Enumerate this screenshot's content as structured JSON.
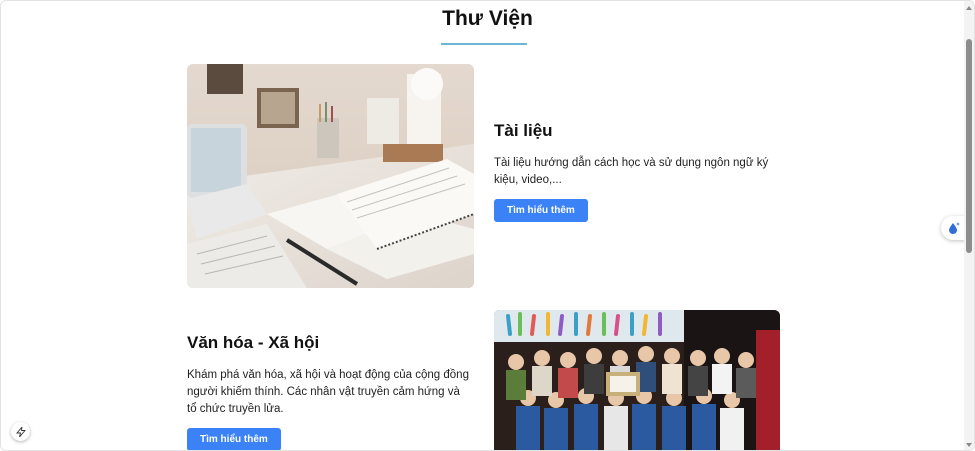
{
  "page": {
    "title": "Thư Viện"
  },
  "sections": [
    {
      "heading": "Tài liệu",
      "description": "Tài liệu hướng dẫn cách học và sử dụng ngôn ngữ ký kiệu, video,...",
      "button_label": "Tìm hiểu thêm",
      "image": "desk-study-photo"
    },
    {
      "heading": "Văn hóa - Xã hội",
      "description": "Khám phá văn hóa, xã hội và hoạt động của cộng đồng người khiếm thính. Các nhân vật truyền cảm hứng và tổ chức truyền lửa.",
      "button_label": "Tìm hiểu thêm",
      "image": "community-group-photo"
    }
  ],
  "widgets": {
    "floating_icon": "water-drop-sparkle-icon",
    "corner_icon": "lightning-icon"
  },
  "colors": {
    "accent": "#3b82f6",
    "underline": "#6bb7d6"
  }
}
